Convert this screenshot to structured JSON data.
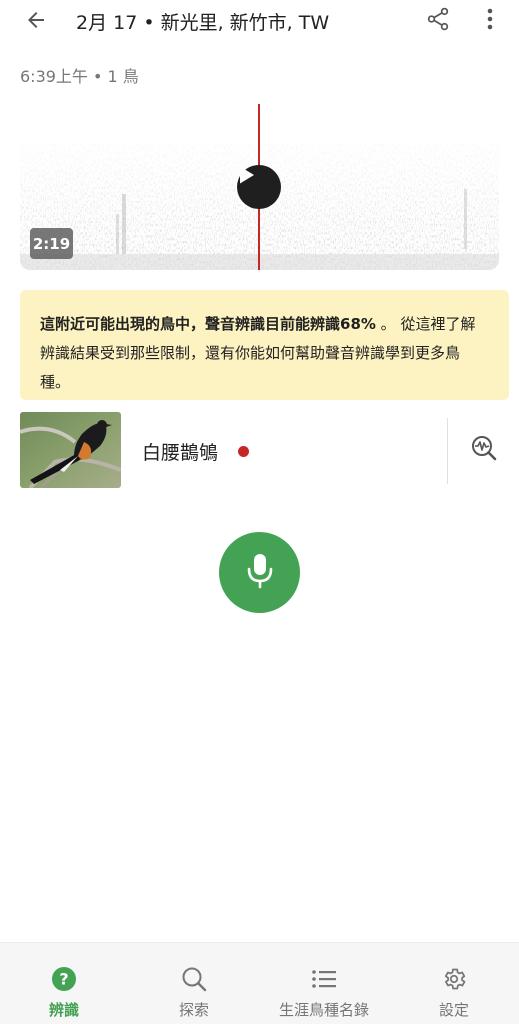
{
  "header": {
    "title": "2月 17 • 新光里, 新竹市, TW",
    "subtitle": "6:39上午 • 1 鳥"
  },
  "recording": {
    "duration": "2:19"
  },
  "banner": {
    "bold_text": "這附近可能出現的鳥中，聲音辨識目前能辨識68%",
    "rest_text": " 。 從這裡了解辨識結果受到那些限制，還有你能如何幫助聲音辨識學到更多鳥種。"
  },
  "result": {
    "species_name": "白腰鵲鴝",
    "dot_color": "#c62828"
  },
  "colors": {
    "accent": "#43a253",
    "banner_bg": "#fdf3c2",
    "playhead": "#c62828"
  },
  "bottom_nav": [
    {
      "label": "辨識",
      "icon": "help-circle-icon",
      "active": true
    },
    {
      "label": "探索",
      "icon": "search-icon",
      "active": false
    },
    {
      "label": "生涯鳥種名錄",
      "icon": "list-icon",
      "active": false
    },
    {
      "label": "設定",
      "icon": "gear-icon",
      "active": false
    }
  ]
}
